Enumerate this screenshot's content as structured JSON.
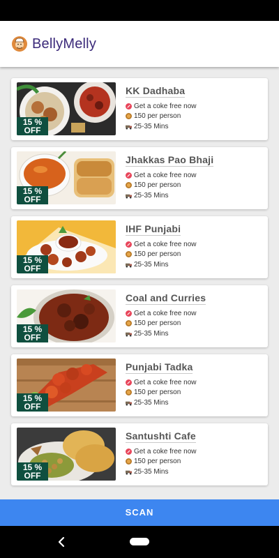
{
  "app": {
    "title": "BellyMelly",
    "logo_icon": "chef-logo-icon"
  },
  "restaurants": [
    {
      "name": "KK Dadhaba",
      "offer": "Get a coke free now",
      "price": "150 per person",
      "time": "25-35 Mins",
      "discount_line1": "15 %",
      "discount_line2": "OFF"
    },
    {
      "name": "Jhakkas Pao Bhaji",
      "offer": "Get a coke free now",
      "price": "150 per person",
      "time": "25-35 Mins",
      "discount_line1": "15 %",
      "discount_line2": "OFF"
    },
    {
      "name": "IHF Punjabi",
      "offer": "Get a coke free now",
      "price": "150 per person",
      "time": "25-35 Mins",
      "discount_line1": "15 %",
      "discount_line2": "OFF"
    },
    {
      "name": "Coal and Curries",
      "offer": "Get a coke free now",
      "price": "150 per person",
      "time": "25-35 Mins",
      "discount_line1": "15 %",
      "discount_line2": "OFF"
    },
    {
      "name": "Punjabi Tadka",
      "offer": "Get a coke free now",
      "price": "150 per person",
      "time": "25-35 Mins",
      "discount_line1": "15 %",
      "discount_line2": "OFF"
    },
    {
      "name": "Santushti Cafe",
      "offer": "Get a coke free now",
      "price": "150 per person",
      "time": "25-35 Mins",
      "discount_line1": "15 %",
      "discount_line2": "OFF"
    }
  ],
  "icons": {
    "offer": "offer-tag-icon",
    "price": "coin-icon",
    "time": "delivery-time-icon"
  },
  "scan_button": {
    "label": "SCAN"
  },
  "colors": {
    "accent": "#3d86f0",
    "title": "#3b2a7a",
    "discount_badge": "#0f4f3f"
  }
}
